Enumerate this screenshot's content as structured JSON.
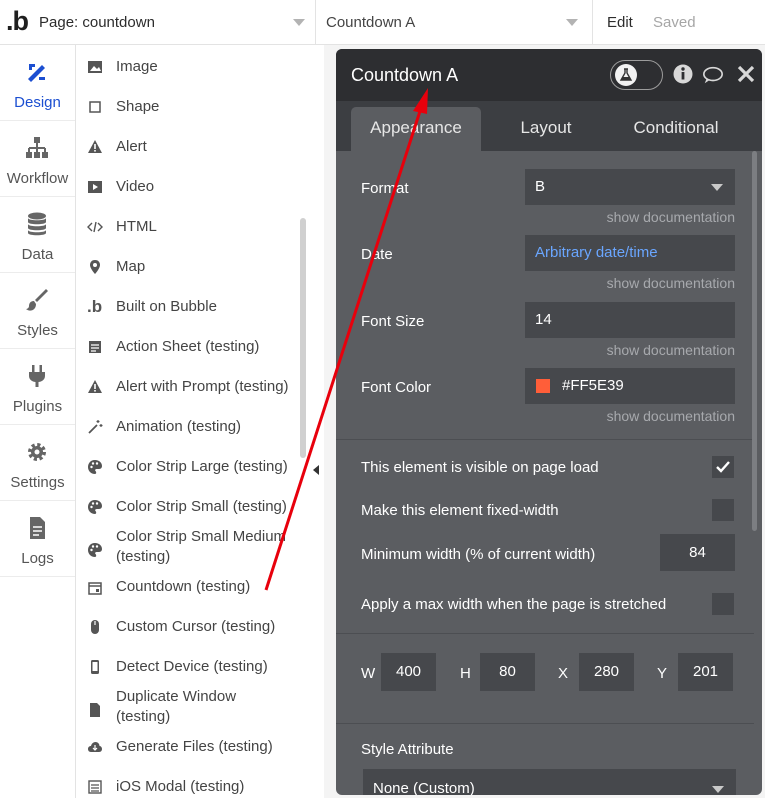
{
  "topbar": {
    "logo": ".b",
    "page_select": "Page: countdown",
    "element_select": "Countdown A",
    "edit": "Edit",
    "saved": "Saved"
  },
  "nav": [
    {
      "label": "Design",
      "icon": "design-icon"
    },
    {
      "label": "Workflow",
      "icon": "workflow-icon"
    },
    {
      "label": "Data",
      "icon": "database-icon"
    },
    {
      "label": "Styles",
      "icon": "brush-icon"
    },
    {
      "label": "Plugins",
      "icon": "plug-icon"
    },
    {
      "label": "Settings",
      "icon": "gear-icon"
    },
    {
      "label": "Logs",
      "icon": "document-icon"
    }
  ],
  "elements": [
    {
      "label": "Image",
      "icon": "image-icon"
    },
    {
      "label": "Shape",
      "icon": "square-icon"
    },
    {
      "label": "Alert",
      "icon": "warning-icon"
    },
    {
      "label": "Video",
      "icon": "play-icon"
    },
    {
      "label": "HTML",
      "icon": "code-icon"
    },
    {
      "label": "Map",
      "icon": "map-pin-icon"
    },
    {
      "label": "Built on Bubble",
      "icon": "bubble-logo-icon"
    },
    {
      "label": "Action Sheet (testing)",
      "icon": "sheet-icon"
    },
    {
      "label": "Alert with Prompt (testing)",
      "icon": "warning-icon"
    },
    {
      "label": "Animation (testing)",
      "icon": "magic-wand-icon"
    },
    {
      "label": "Color Strip Large (testing)",
      "icon": "palette-icon"
    },
    {
      "label": "Color Strip Small (testing)",
      "icon": "palette-icon"
    },
    {
      "label": "Color Strip Small Medium",
      "label2": "(testing)",
      "icon": "palette-icon"
    },
    {
      "label": "Countdown (testing)",
      "icon": "calendar-icon"
    },
    {
      "label": "Custom Cursor (testing)",
      "icon": "mouse-icon"
    },
    {
      "label": "Detect Device (testing)",
      "icon": "phone-icon"
    },
    {
      "label": "Duplicate Window",
      "label2": "(testing)",
      "icon": "file-icon"
    },
    {
      "label": "Generate Files (testing)",
      "icon": "cloud-icon"
    },
    {
      "label": "iOS Modal (testing)",
      "icon": "list-icon"
    }
  ],
  "editor": {
    "title": "Countdown A",
    "tabs": [
      "Appearance",
      "Layout",
      "Conditional"
    ],
    "properties": {
      "format_label": "Format",
      "format_value": "B",
      "date_label": "Date",
      "date_value": "Arbitrary date/time",
      "font_size_label": "Font Size",
      "font_size_value": "14",
      "font_color_label": "Font Color",
      "font_color_value": "#FF5E39",
      "doc_link": "show documentation"
    },
    "visibility": {
      "visible_label": "This element is visible on page load",
      "visible_checked": true,
      "fixed_width_label": "Make this element fixed-width",
      "fixed_width_checked": false,
      "min_width_label": "Minimum width (% of current width)",
      "min_width_value": "84",
      "max_width_label": "Apply a max width when the page is stretched",
      "max_width_checked": false
    },
    "geometry": {
      "w_label": "W",
      "w_value": "400",
      "h_label": "H",
      "h_value": "80",
      "x_label": "X",
      "x_value": "280",
      "y_label": "Y",
      "y_value": "201"
    },
    "style": {
      "label": "Style Attribute",
      "value": "None (Custom)"
    }
  },
  "colors": {
    "accent": "#1c4fd1",
    "annotation": "#e8000c",
    "font_color": "#FF5E39"
  }
}
